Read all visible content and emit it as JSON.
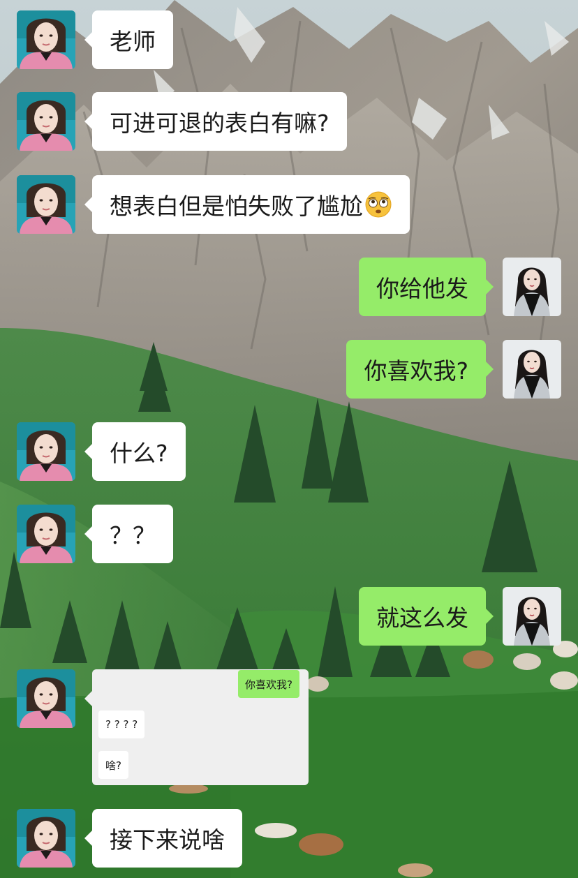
{
  "chat": {
    "messages": [
      {
        "side": "left",
        "text": "老师"
      },
      {
        "side": "left",
        "text": "可进可退的表白有嘛?"
      },
      {
        "side": "left",
        "text": "想表白但是怕失败了尴尬"
      },
      {
        "side": "right",
        "text": "你给他发"
      },
      {
        "side": "right",
        "text": "你喜欢我?"
      },
      {
        "side": "left",
        "text": "什么?"
      },
      {
        "side": "left",
        "text": "？？"
      },
      {
        "side": "right",
        "text": "就这么发"
      },
      {
        "side": "left",
        "type": "screenshot"
      },
      {
        "side": "left",
        "text": "接下来说啥"
      }
    ],
    "emoji_icon": "flushed-face-emoji",
    "screenshot": {
      "right_message": "你喜欢我?",
      "reply_1": "? ? ? ?",
      "reply_2": "啥?"
    }
  },
  "colors": {
    "sent_bubble": "#95ec69",
    "received_bubble": "#ffffff",
    "screenshot_card": "#efefef"
  },
  "avatars": {
    "left_icon": "female-avatar-pink-jacket",
    "right_icon": "female-avatar-black-dress"
  }
}
